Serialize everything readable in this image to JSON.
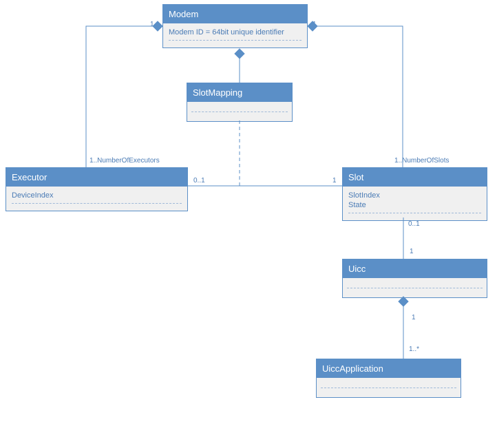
{
  "classes": {
    "modem": {
      "name": "Modem",
      "attrs": [
        "Modem ID = 64bit unique identifier"
      ]
    },
    "slotmapping": {
      "name": "SlotMapping",
      "attrs": []
    },
    "executor": {
      "name": "Executor",
      "attrs": [
        "DeviceIndex"
      ]
    },
    "slot": {
      "name": "Slot",
      "attrs": [
        "SlotIndex",
        "State"
      ]
    },
    "uicc": {
      "name": "Uicc",
      "attrs": []
    },
    "uiccapp": {
      "name": "UiccApplication",
      "attrs": []
    }
  },
  "mult": {
    "modem_left": "1",
    "modem_right": "1",
    "exec_top": "1..NumberOfExecutors",
    "slot_top": "1..NumberOfSlots",
    "exec_right": "0..1",
    "slot_left": "1",
    "slot_bottom": "0..1",
    "uicc_top": "1",
    "uicc_bottom": "1",
    "uiccapp_top": "1..*"
  }
}
